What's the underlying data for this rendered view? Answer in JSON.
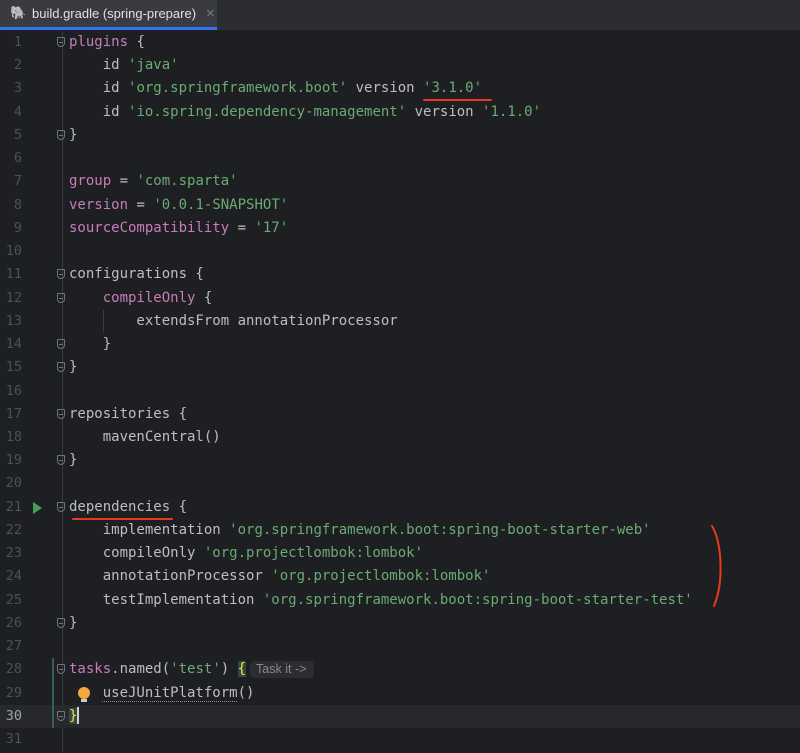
{
  "tab": {
    "title": "build.gradle (spring-prepare)",
    "icon": "gradle-elephant-icon",
    "close": "×"
  },
  "editor": {
    "current_line": 30,
    "lines": [
      {
        "n": "1",
        "fold": true,
        "segs": [
          [
            "kw",
            "plugins"
          ],
          [
            "pl",
            " {"
          ]
        ]
      },
      {
        "n": "2",
        "segs": [
          [
            "pl",
            "    id "
          ],
          [
            "str",
            "'java'"
          ]
        ]
      },
      {
        "n": "3",
        "segs": [
          [
            "pl",
            "    id "
          ],
          [
            "str",
            "'org.springframework.boot'"
          ],
          [
            "pl",
            " version "
          ],
          [
            "str",
            "'3.1.0'"
          ]
        ]
      },
      {
        "n": "4",
        "segs": [
          [
            "pl",
            "    id "
          ],
          [
            "str",
            "'io.spring.dependency-management'"
          ],
          [
            "pl",
            " version "
          ],
          [
            "str",
            "'1.1.0'"
          ]
        ]
      },
      {
        "n": "5",
        "fold": true,
        "segs": [
          [
            "pl",
            "}"
          ]
        ]
      },
      {
        "n": "6",
        "segs": []
      },
      {
        "n": "7",
        "segs": [
          [
            "kw",
            "group"
          ],
          [
            "pl",
            " = "
          ],
          [
            "str",
            "'com.sparta'"
          ]
        ]
      },
      {
        "n": "8",
        "segs": [
          [
            "kw",
            "version"
          ],
          [
            "pl",
            " = "
          ],
          [
            "str",
            "'0.0.1-SNAPSHOT'"
          ]
        ]
      },
      {
        "n": "9",
        "segs": [
          [
            "kw",
            "sourceCompatibility"
          ],
          [
            "pl",
            " = "
          ],
          [
            "str",
            "'17'"
          ]
        ]
      },
      {
        "n": "10",
        "segs": []
      },
      {
        "n": "11",
        "fold": true,
        "segs": [
          [
            "pl",
            "configurations {"
          ]
        ]
      },
      {
        "n": "12",
        "fold": true,
        "segs": [
          [
            "pl",
            "    "
          ],
          [
            "kw",
            "compileOnly"
          ],
          [
            "pl",
            " {"
          ]
        ]
      },
      {
        "n": "13",
        "segs": [
          [
            "pl",
            "        extendsFrom annotationProcessor"
          ]
        ]
      },
      {
        "n": "14",
        "fold": true,
        "segs": [
          [
            "pl",
            "    }"
          ]
        ]
      },
      {
        "n": "15",
        "fold": true,
        "segs": [
          [
            "pl",
            "}"
          ]
        ]
      },
      {
        "n": "16",
        "segs": []
      },
      {
        "n": "17",
        "fold": true,
        "segs": [
          [
            "pl",
            "repositories {"
          ]
        ]
      },
      {
        "n": "18",
        "segs": [
          [
            "pl",
            "    mavenCentral()"
          ]
        ]
      },
      {
        "n": "19",
        "fold": true,
        "segs": [
          [
            "pl",
            "}"
          ]
        ]
      },
      {
        "n": "20",
        "segs": []
      },
      {
        "n": "21",
        "fold": true,
        "run": true,
        "segs": [
          [
            "pl",
            "dependencies {"
          ]
        ]
      },
      {
        "n": "22",
        "segs": [
          [
            "pl",
            "    implementation "
          ],
          [
            "str",
            "'org.springframework.boot:spring-boot-starter-web'"
          ]
        ]
      },
      {
        "n": "23",
        "segs": [
          [
            "pl",
            "    compileOnly "
          ],
          [
            "str",
            "'org.projectlombok:lombok'"
          ]
        ]
      },
      {
        "n": "24",
        "segs": [
          [
            "pl",
            "    annotationProcessor "
          ],
          [
            "str",
            "'org.projectlombok:lombok'"
          ]
        ]
      },
      {
        "n": "25",
        "segs": [
          [
            "pl",
            "    testImplementation "
          ],
          [
            "str",
            "'org.springframework.boot:spring-boot-starter-test'"
          ]
        ]
      },
      {
        "n": "26",
        "fold": true,
        "segs": [
          [
            "pl",
            "}"
          ]
        ]
      },
      {
        "n": "27",
        "segs": []
      },
      {
        "n": "28",
        "fold": true,
        "segs": [
          [
            "kw",
            "tasks"
          ],
          [
            "pl",
            ".named("
          ],
          [
            "str",
            "'test'"
          ],
          [
            "pl",
            ") "
          ],
          [
            "br",
            "{"
          ],
          [
            "hint",
            "Task it ->"
          ]
        ]
      },
      {
        "n": "29",
        "bulb": true,
        "segs": [
          [
            "pl",
            "    "
          ],
          [
            "deprec",
            "useJUnitPlatform"
          ],
          [
            "pl",
            "()"
          ]
        ]
      },
      {
        "n": "30",
        "fold": true,
        "segs": [
          [
            "br",
            "}"
          ],
          [
            "caret",
            ""
          ]
        ]
      },
      {
        "n": "31",
        "segs": []
      }
    ]
  }
}
